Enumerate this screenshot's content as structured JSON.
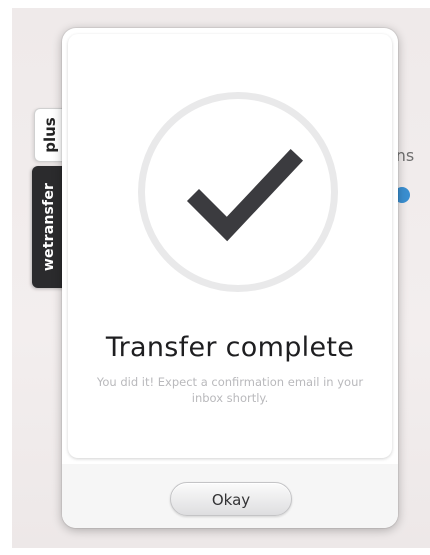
{
  "background": {
    "partial_text": "ons"
  },
  "side_tabs": {
    "plus_label": "plus",
    "brand_label": "wetransfer"
  },
  "dialog": {
    "icon": "checkmark-icon",
    "title": "Transfer complete",
    "message": "You did it! Expect a confirmation email in your inbox shortly.",
    "okay_label": "Okay"
  },
  "colors": {
    "checkmark": "#3b3b3f",
    "circle_ring": "#e9e9ea",
    "brand_tab": "#2b2b2d",
    "background_accent": "#3a8fd1"
  }
}
